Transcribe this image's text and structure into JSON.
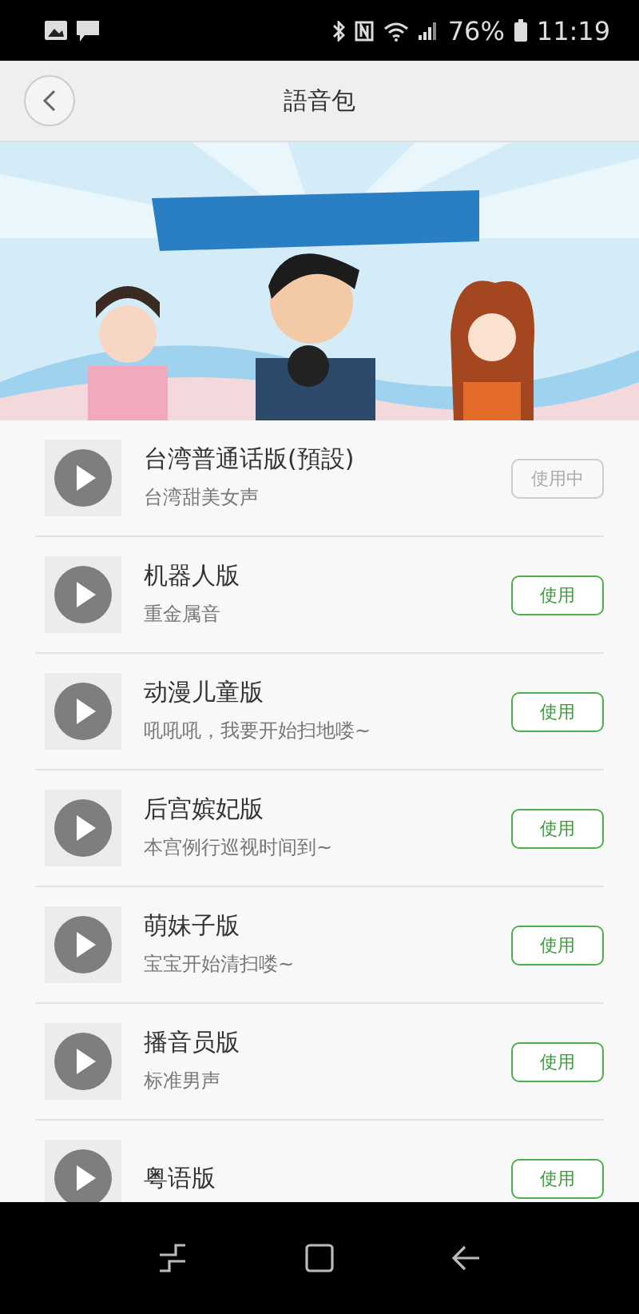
{
  "status_bar": {
    "battery": "76%",
    "time": "11:19"
  },
  "header": {
    "title": "語音包"
  },
  "voice_packs": [
    {
      "title": "台湾普通话版(預設)",
      "subtitle": "台湾甜美女声",
      "button": "使用中",
      "in_use": true
    },
    {
      "title": "机器人版",
      "subtitle": "重金属音",
      "button": "使用",
      "in_use": false
    },
    {
      "title": "动漫儿童版",
      "subtitle": "吼吼吼，我要开始扫地喽~",
      "button": "使用",
      "in_use": false
    },
    {
      "title": "后宫嫔妃版",
      "subtitle": "本宫例行巡视时间到~",
      "button": "使用",
      "in_use": false
    },
    {
      "title": "萌妹子版",
      "subtitle": "宝宝开始清扫喽~",
      "button": "使用",
      "in_use": false
    },
    {
      "title": "播音员版",
      "subtitle": "标准男声",
      "button": "使用",
      "in_use": false
    },
    {
      "title": "粤语版",
      "button": "使用",
      "in_use": false
    }
  ]
}
